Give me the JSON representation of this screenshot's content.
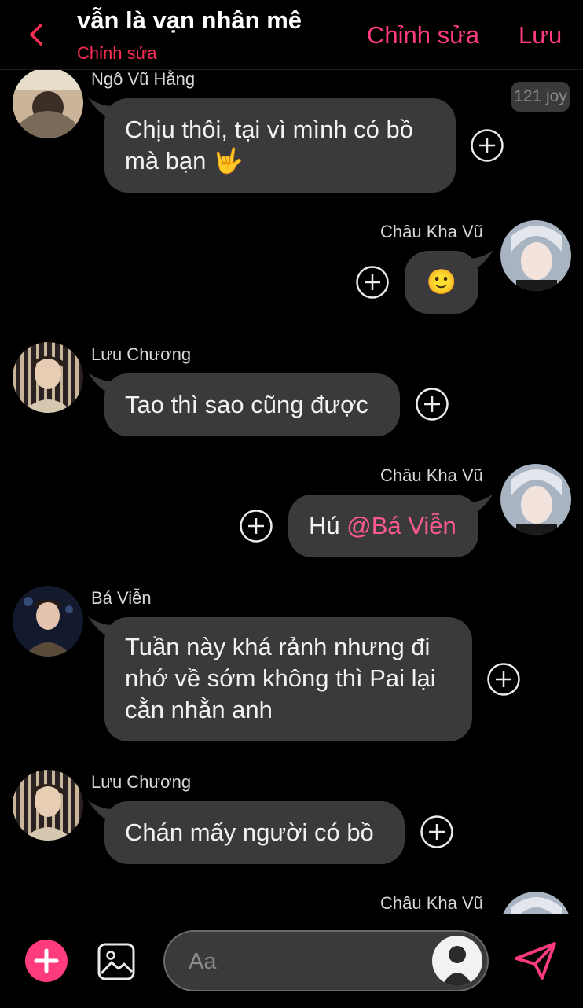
{
  "header": {
    "title": "vẫn là vạn nhân mê",
    "subtitle": "Chỉnh sửa",
    "edit_label": "Chỉnh sửa",
    "save_label": "Lưu"
  },
  "badge": "121 joy",
  "messages": [
    {
      "sender": "Ngô Vũ Hằng",
      "text": "Chịu thôi, tại vì mình có bồ",
      "text2": "mà bạn"
    },
    {
      "sender": "Châu Kha Vũ",
      "text": "🙂"
    },
    {
      "sender": "Lưu Chương",
      "text": "Tao thì sao cũng được"
    },
    {
      "sender": "Châu Kha Vũ",
      "text": "Hú ",
      "mention": "@Bá Viễn"
    },
    {
      "sender": "Bá Viễn",
      "line1": "Tuần này khá rảnh nhưng đi",
      "line2": "nhớ về sớm không thì Pai lại",
      "line3": "cằn nhằn anh"
    },
    {
      "sender": "Lưu Chương",
      "text": "Chán mấy người có bồ"
    },
    {
      "sender": "Châu Kha Vũ"
    }
  ],
  "composer": {
    "placeholder": "Aa"
  },
  "colors": {
    "accent": "#ff3b7f",
    "bubble": "#3a3a3c",
    "background": "#000000"
  }
}
